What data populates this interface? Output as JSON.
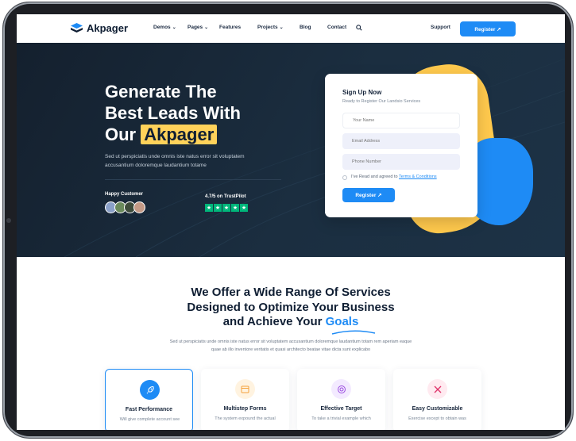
{
  "brand": {
    "name": "Akpager",
    "accent": "#1e8bf5",
    "highlight": "#ffd25a",
    "dark": "#14202e"
  },
  "nav": {
    "items": [
      {
        "label": "Demos",
        "dropdown": true
      },
      {
        "label": "Pages",
        "dropdown": true
      },
      {
        "label": "Features",
        "dropdown": false
      },
      {
        "label": "Projects",
        "dropdown": true
      },
      {
        "label": "Blog",
        "dropdown": false
      },
      {
        "label": "Contact",
        "dropdown": false
      }
    ],
    "search_icon": "search-icon",
    "support": "Support",
    "register": "Register ↗"
  },
  "hero": {
    "title_line1": "Generate The",
    "title_line2": "Best Leads With",
    "title_line3_prefix": "Our",
    "title_highlight": "Akpager",
    "text_line1": "Sed ut perspiciatis unde omnis iste natus error sit voluptatem",
    "text_line2": "accusantium doloremque laudantium totame",
    "happy_customer": "Happy Customer",
    "rating": "4.7/5 on TrustPilot",
    "stars": 5
  },
  "signup": {
    "title": "Sign Up Now",
    "subtitle": "Ready to Register Our Landsio Services",
    "name_placeholder": "Your Name",
    "email_placeholder": "Email Address",
    "phone_placeholder": "Phone Number",
    "terms_prefix": "I've Read and agreed to",
    "terms_link": "Terms & Conditions",
    "button": "Register ↗"
  },
  "services": {
    "heading_line1": "We Offer a Wide Range Of Services",
    "heading_line2": "Designed to Optimize Your Business",
    "heading_line3_prefix": "and Achieve Your",
    "heading_highlight": "Goals",
    "text_line1": "Sed ut perspiciatis unde omnis iste natus error sit voluptatem accusantium doloremque laudantium totam rem aperiam eaque",
    "text_line2": "quae ab illo inventore veritatis et quasi architecto beatae vitae dicta sunt explicabo",
    "features": [
      {
        "title": "Fast Performance",
        "desc": "Will give complete account see",
        "icon": "rocket-icon",
        "bg": "#1e8bf5"
      },
      {
        "title": "Multistep Forms",
        "desc": "The system expound the actual",
        "icon": "calendar-icon",
        "bg": "#fff3e0"
      },
      {
        "title": "Effective Target",
        "desc": "To take a trivial example which",
        "icon": "target-icon",
        "bg": "#f3eaff"
      },
      {
        "title": "Easy Customizable",
        "desc": "Exercise except to obtain was",
        "icon": "tools-icon",
        "bg": "#ffeaf0"
      }
    ]
  }
}
